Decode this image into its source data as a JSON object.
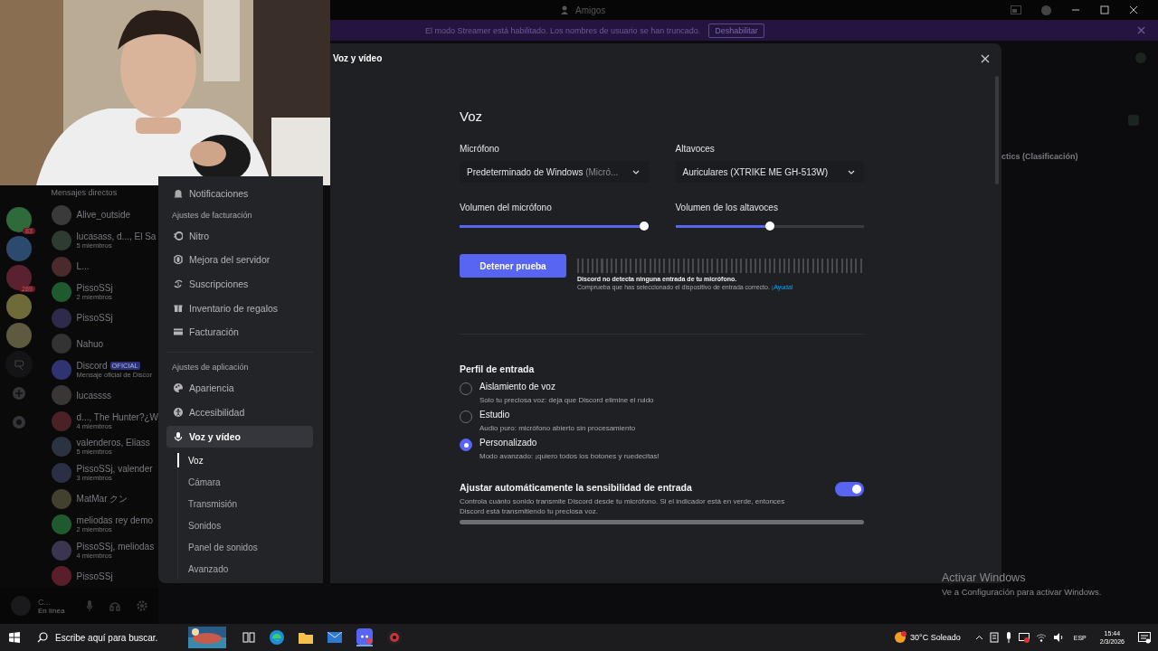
{
  "top_bar": {
    "title": "Amigos"
  },
  "banner": {
    "text": "El modo Streamer está habilitado. Los nombres de usuario se han truncado.",
    "button": "Deshabilitar"
  },
  "servers": [
    {
      "kind": "avatar",
      "color": "#2f6b3a",
      "badge": "83"
    },
    {
      "kind": "avatar",
      "color": "#2b4a6e"
    },
    {
      "kind": "avatar",
      "color": "#5a2230",
      "badge": "289"
    },
    {
      "kind": "avatar",
      "color": "#6e6a3a"
    },
    {
      "kind": "avatar",
      "color": "#5e5a40"
    },
    {
      "kind": "glyph"
    },
    {
      "kind": "add"
    },
    {
      "kind": "explore"
    }
  ],
  "dm_list": {
    "header": "Mensajes directos",
    "items": [
      {
        "name": "Alive_outside",
        "color": "#3a3a3a"
      },
      {
        "name": "lucasass, d..., El Sa",
        "subtitle": "5 miembros",
        "color": "#2d3b30"
      },
      {
        "name": "L...",
        "color": "#4a2a2a"
      },
      {
        "name": "PissoSSj",
        "subtitle": "2 miembros",
        "color": "#1f5a2e"
      },
      {
        "name": "PissoSSj",
        "color": "#2e2a4a"
      },
      {
        "name": "Nahuo",
        "color": "#333333"
      },
      {
        "name": "Discord",
        "tag": "OFICIAL",
        "subtitle": "Mensaje oficial de Discor",
        "color": "#2f3470"
      },
      {
        "name": "lucassss",
        "color": "#3a3636"
      },
      {
        "name": "d..., The Hunter?¿W",
        "subtitle": "4 miembros",
        "color": "#4a2226"
      },
      {
        "name": "valenderos, Eliass",
        "subtitle": "5 miembros",
        "color": "#2a3340"
      },
      {
        "name": "PissoSSj, valender",
        "subtitle": "3 miembros",
        "color": "#2a2f45"
      },
      {
        "name": "MatMar クン",
        "color": "#44402e"
      },
      {
        "name": "meliodas rey demo",
        "subtitle": "2 miembros",
        "color": "#1f5a2e"
      },
      {
        "name": "PissoSSj, meliodas",
        "subtitle": "4 miembros",
        "color": "#3c3550"
      },
      {
        "name": "PissoSSj",
        "color": "#5a1e2a"
      }
    ]
  },
  "user_panel": {
    "name": "C...",
    "status": "En línea"
  },
  "activity": {
    "text": "ctics (Clasificación)"
  },
  "settings_sidebar": {
    "sections": [
      {
        "items": [
          {
            "label": "Notificaciones",
            "selected": false
          }
        ]
      },
      {
        "heading": "Ajustes de facturación",
        "items": [
          {
            "label": "Nitro",
            "selected": false
          },
          {
            "label": "Mejora del servidor",
            "selected": false
          },
          {
            "label": "Suscripciones",
            "selected": false
          },
          {
            "label": "Inventario de regalos",
            "selected": false
          },
          {
            "label": "Facturación",
            "selected": false
          }
        ]
      },
      {
        "heading": "Ajustes de aplicación",
        "items": [
          {
            "label": "Apariencia",
            "selected": false
          },
          {
            "label": "Accesibilidad",
            "selected": false
          },
          {
            "label": "Voz y vídeo",
            "selected": true,
            "children": [
              {
                "label": "Voz",
                "selected": true
              },
              {
                "label": "Cámara",
                "selected": false
              },
              {
                "label": "Transmisión",
                "selected": false
              },
              {
                "label": "Sonidos",
                "selected": false
              },
              {
                "label": "Panel de sonidos",
                "selected": false
              },
              {
                "label": "Avanzado",
                "selected": false
              }
            ]
          }
        ]
      }
    ]
  },
  "modal": {
    "title": "Voz y vídeo",
    "heading": "Voz",
    "devices": [
      {
        "label": "Micrófono",
        "value": "Predeterminado de Windows",
        "value_note": "(Micró..."
      },
      {
        "label": "Altavoces",
        "value": "Auriculares (XTRIKE ME GH-513W)"
      }
    ],
    "volumes": [
      {
        "label": "Volumen del micrófono",
        "level": 1
      },
      {
        "label": "Volumen de los altavoces",
        "level": 0.5
      }
    ],
    "test_button": "Detener prueba",
    "mic_meter": {
      "level": 0
    },
    "warning": "Discord no detecta ninguna entrada de tu micrófono.",
    "hint": "Comprueba que has seleccionado el dispositivo de entrada correcto.",
    "help_link": "¡Ayuda!",
    "profile": {
      "heading": "Perfil de entrada",
      "options": [
        {
          "label": "Aislamiento de voz",
          "description": "Solo tu preciosa voz: deja que Discord elimine el ruido",
          "selected": false
        },
        {
          "label": "Estudio",
          "description": "Audio puro: micrófono abierto sin procesamiento",
          "selected": false
        },
        {
          "label": "Personalizado",
          "description": "Modo avanzado: ¡quiero todos los botones y ruedecitas!",
          "selected": true
        }
      ]
    },
    "auto_sensitivity": {
      "label": "Ajustar automáticamente la sensibilidad de entrada",
      "description": "Controla cuánto sonido transmite Discord desde tu micrófono. Si el indicador está en verde, entonces Discord está transmitiendo tu preciosa voz.",
      "on": true
    }
  },
  "activation": {
    "title": "Activar Windows",
    "text": "Ve a Configuración para activar Windows."
  },
  "taskbar": {
    "search": "Escribe aquí para buscar.",
    "weather": "30°C Soleado",
    "language": "ESP",
    "time": "15:44",
    "date": "2/3/2026"
  }
}
